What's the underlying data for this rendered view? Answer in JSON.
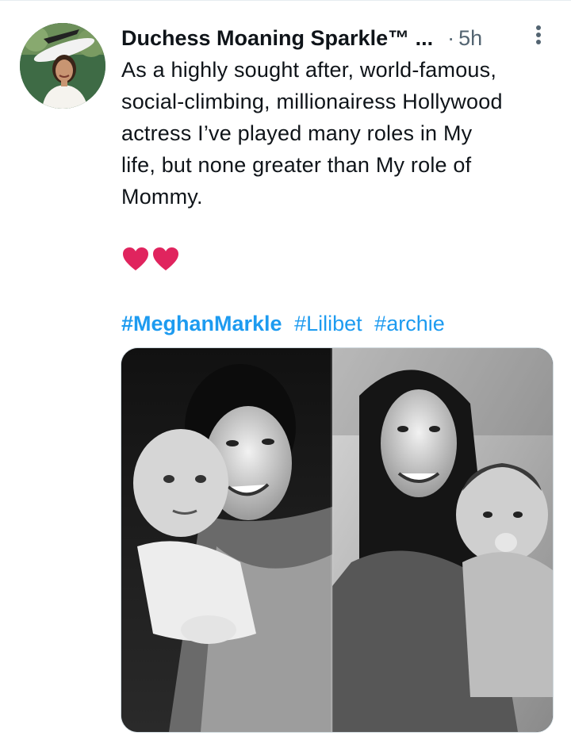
{
  "tweet": {
    "display_name": "Duchess Moaning Sparkle™ ...",
    "separator": "·",
    "time": "5h",
    "text": "As a highly sought after, world-famous,\nsocial-climbing, millionairess Hollywood\nactress I’ve played many roles in My\nlife, but none greater than My role of\nMommy.",
    "emoji": "red-heart red-heart",
    "hashtags": [
      {
        "label": "#MeghanMarkle"
      },
      {
        "label": "#Lilibet"
      },
      {
        "label": "#archie"
      }
    ],
    "media_description": "two black and white photos of a smiling woman holding a baby"
  },
  "colors": {
    "link": "#1d9bf0",
    "text": "#0f1419",
    "secondary": "#536471",
    "heart": "#e0245e"
  },
  "icons": {
    "more": "more-vertical-icon",
    "heart": "heart-icon"
  }
}
